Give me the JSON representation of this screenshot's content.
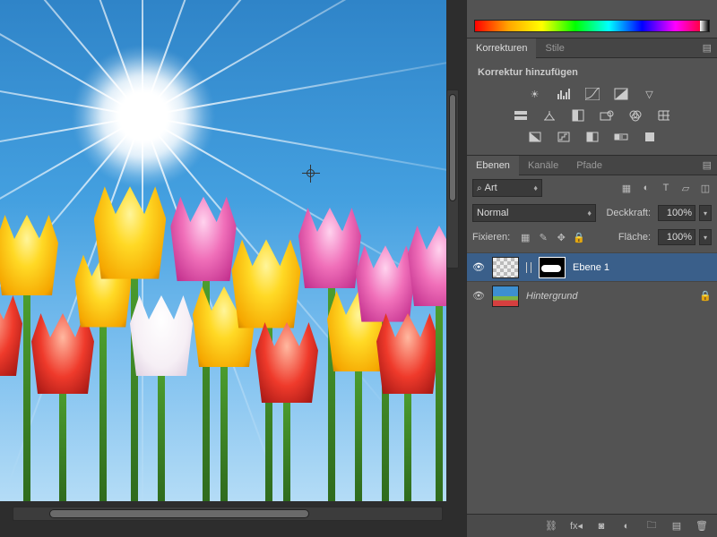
{
  "panels": {
    "adjustments": {
      "tab1": "Korrekturen",
      "tab2": "Stile",
      "add_label": "Korrektur hinzufügen"
    },
    "layers": {
      "tabs": {
        "layers": "Ebenen",
        "channels": "Kanäle",
        "paths": "Pfade"
      },
      "filter_kind_prefix": "⌕",
      "filter_kind": "Art",
      "blend_mode": "Normal",
      "opacity_label": "Deckkraft:",
      "opacity_value": "100%",
      "fill_label": "Fläche:",
      "fill_value": "100%",
      "lock_label": "Fixieren:",
      "items": [
        {
          "name": "Ebene 1",
          "has_mask": true,
          "visible": true,
          "locked": false,
          "selected": true,
          "thumb": "checker"
        },
        {
          "name": "Hintergrund",
          "has_mask": false,
          "visible": true,
          "locked": true,
          "selected": false,
          "thumb": "photo",
          "italic": true
        }
      ]
    }
  }
}
